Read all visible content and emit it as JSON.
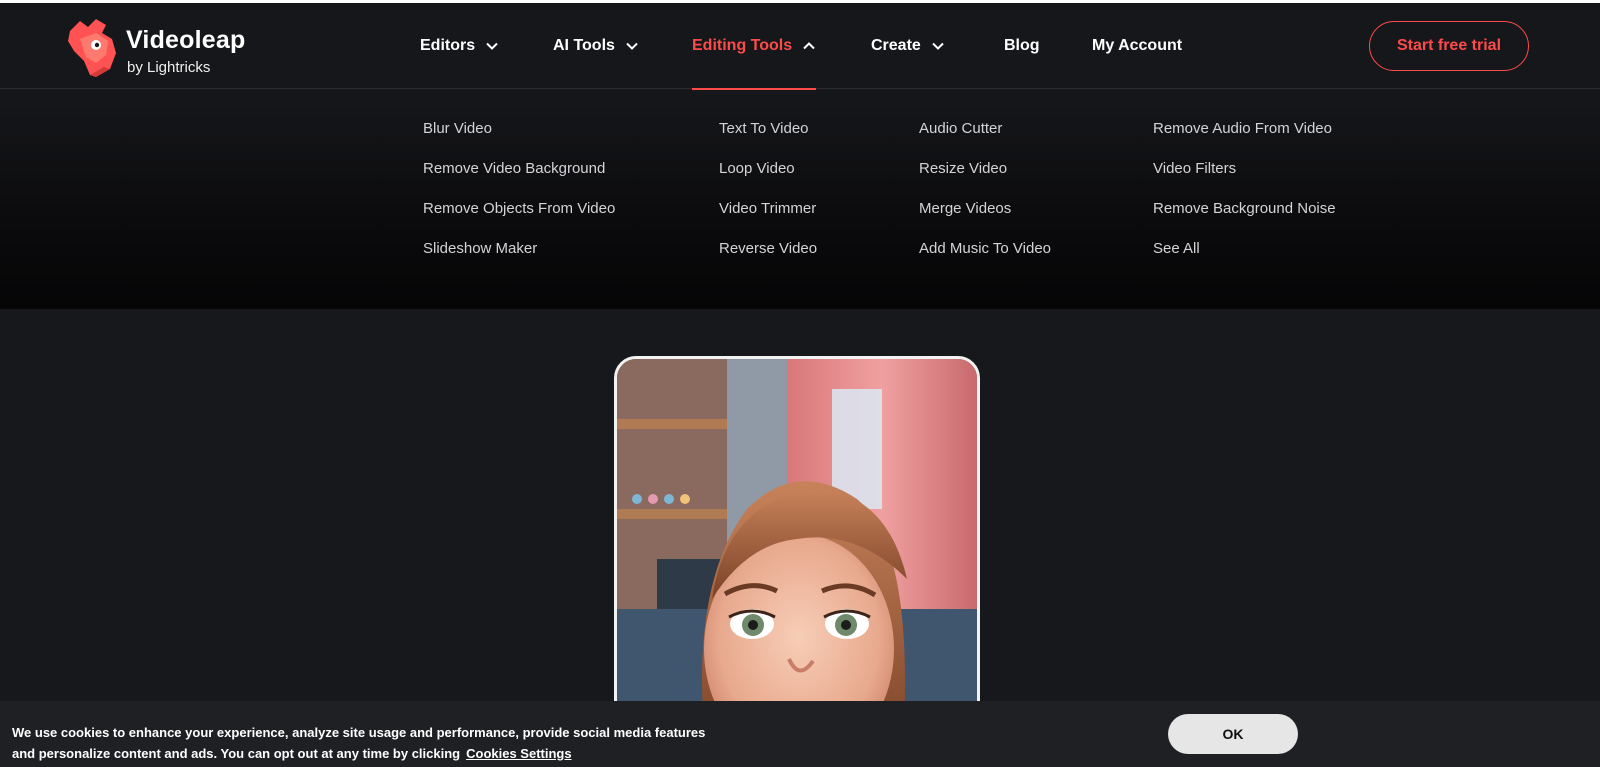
{
  "brand": {
    "name": "Videoleap",
    "sub": "by Lightricks",
    "accent": "#ff4a4a"
  },
  "nav": {
    "items": [
      {
        "label": "Editors",
        "icon": "chevron-down-icon"
      },
      {
        "label": "AI Tools",
        "icon": "chevron-down-icon"
      },
      {
        "label": "Editing Tools",
        "icon": "chevron-up-icon",
        "active": true
      },
      {
        "label": "Create",
        "icon": "chevron-down-icon"
      },
      {
        "label": "Blog"
      },
      {
        "label": "My Account"
      }
    ],
    "cta": "Start free trial"
  },
  "mega_menu": {
    "columns": [
      [
        "Blur Video",
        "Remove Video Background",
        "Remove Objects From Video",
        "Slideshow Maker"
      ],
      [
        "Text To Video",
        "Loop Video",
        "Video Trimmer",
        "Reverse Video"
      ],
      [
        "Audio Cutter",
        "Resize Video",
        "Merge Videos",
        "Add Music To Video"
      ],
      [
        "Remove Audio From Video",
        "Video Filters",
        "Remove Background Noise",
        "See All"
      ]
    ]
  },
  "cookie": {
    "text": "We use cookies to enhance your experience, analyze site usage and performance, provide social media features and personalize content and ads. You can opt out at any time by clicking",
    "link": "Cookies Settings",
    "ok": "OK"
  }
}
